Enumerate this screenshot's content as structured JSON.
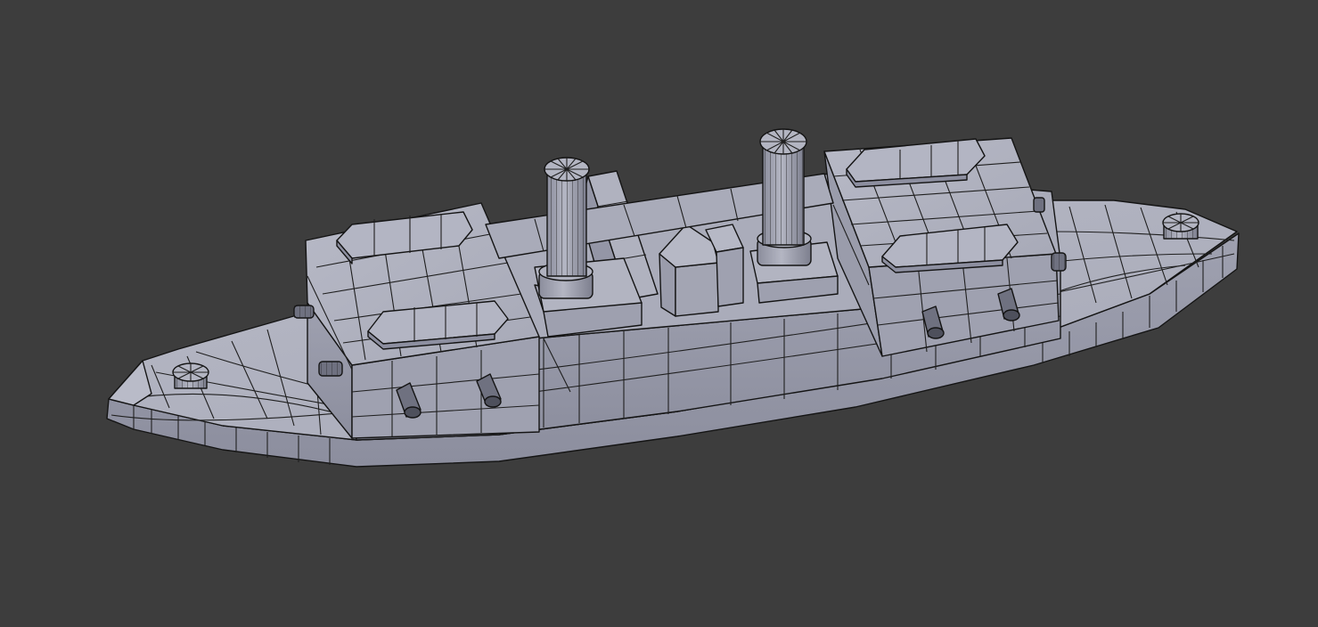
{
  "viewport": {
    "background": "#3d3d3d",
    "shading": "solid",
    "overlay": "wireframe",
    "model": {
      "colors": {
        "top": "#aeb0be",
        "side": "#9597a7",
        "side_dark": "#7f8191",
        "side_light": "#b9bbc8",
        "wire": "#1f1f1f",
        "shadow": "#2e2e2e"
      }
    }
  }
}
